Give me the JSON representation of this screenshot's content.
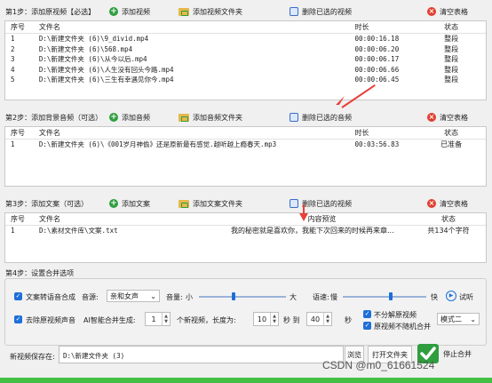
{
  "step1": {
    "label": "第1步：添加原视频【必选】",
    "add_video": "添加视频",
    "add_folder": "添加视频文件夹",
    "delete_selected": "删除已选的视频",
    "clear": "清空表格",
    "headers": {
      "idx": "序号",
      "name": "文件名",
      "duration": "时长",
      "status": "状态"
    },
    "rows": [
      {
        "idx": "1",
        "name": "D:\\新建文件夹 (6)\\9_divid.mp4",
        "duration": "00:00:16.18",
        "status": "整段"
      },
      {
        "idx": "2",
        "name": "D:\\新建文件夹 (6)\\568.mp4",
        "duration": "00:00:06.20",
        "status": "整段"
      },
      {
        "idx": "3",
        "name": "D:\\新建文件夹 (6)\\从今以后.mp4",
        "duration": "00:00:06.17",
        "status": "整段"
      },
      {
        "idx": "4",
        "name": "D:\\新建文件夹 (6)\\人生没有回头今路.mp4",
        "duration": "00:00:06.66",
        "status": "整段"
      },
      {
        "idx": "5",
        "name": "D:\\新建文件夹 (6)\\三生有幸遇见你今.mp4",
        "duration": "00:00:06.45",
        "status": "整段"
      }
    ]
  },
  "step2": {
    "label": "第2步：添加背景音频（可选）",
    "add_audio": "添加音频",
    "add_folder": "添加音频文件夹",
    "delete_selected": "删除已选的音频",
    "clear": "清空表格",
    "headers": {
      "idx": "序号",
      "name": "文件名",
      "duration": "时长",
      "status": "状态"
    },
    "rows": [
      {
        "idx": "1",
        "name": "D:\\新建文件夹 (6)\\《001岁月神偷》还是原新最有感觉.越听越上瘾春天.mp3",
        "duration": "00:03:56.83",
        "status": "已准备"
      }
    ]
  },
  "step3": {
    "label": "第3步：添加文案（可选）",
    "add_text": "添加文案",
    "add_folder": "添加文案文件夹",
    "delete_selected": "删除已选的视频",
    "clear": "清空表格",
    "headers": {
      "idx": "序号",
      "name": "文件名",
      "preview": "内容预览",
      "status": "状态"
    },
    "rows": [
      {
        "idx": "1",
        "name": "D:\\素材文件库\\文案.txt",
        "preview": "我的秘密就是喜欢你，我能下次回来的时候再来章...",
        "status": "共134个字符"
      }
    ]
  },
  "step4": {
    "label": "第4步：设置合并选项",
    "tts_label": "文案转语音合成",
    "voice_label": "音源:",
    "voice_value": "亲和女声",
    "volume_label": "音量:",
    "volume_small": "小",
    "volume_big": "大",
    "volume_level": 0.38,
    "speed_label": "语速:",
    "speed_slow": "慢",
    "speed_fast": "快",
    "speed_level": 0.55,
    "listen": "试听",
    "remove_audio": "去除原视频声音",
    "ai_label": "AI智能合并生成:",
    "ai_count": "1",
    "ai_unit": "个新视频，长度为:",
    "len_min": "10",
    "len_to": "秒 到",
    "len_max": "40",
    "len_sec": "秒",
    "no_split": "不分解原视频",
    "no_random": "原视频不随机合并",
    "mode_value": "模式二"
  },
  "output": {
    "save_label": "新视频保存在:",
    "save_path": "D:\\新建文件夹 (3)",
    "browse": "浏览",
    "open_folder": "打开文件夹",
    "stop": "停止合并"
  },
  "watermark": "CSDN @m0_61661524",
  "colors": {
    "accent": "#1e6fd9",
    "progress": "#43c043",
    "arrow": "#e8403a"
  }
}
